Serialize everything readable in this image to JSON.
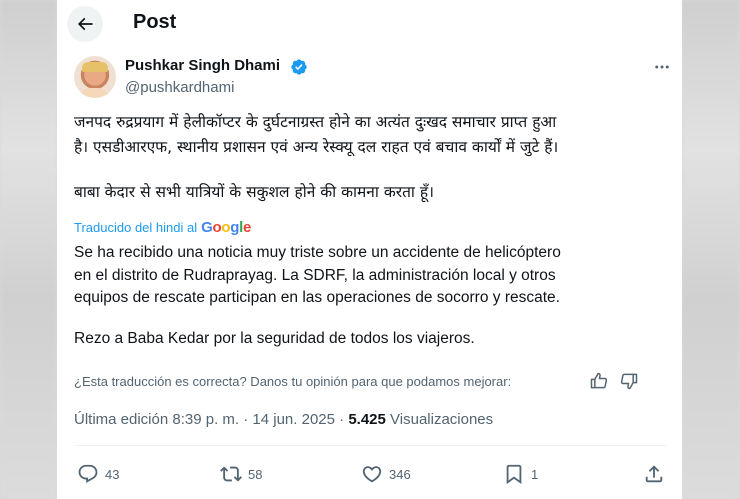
{
  "header": {
    "title": "Post",
    "back_icon": "arrow-left-icon"
  },
  "author": {
    "name": "Pushkar Singh Dhami",
    "handle": "@pushkardhami",
    "verified": true,
    "verified_color": "#1d9bf0"
  },
  "post": {
    "original_paragraphs": [
      "जनपद रुद्रप्रयाग में हेलीकॉप्टर के दुर्घटनाग्रस्त होने का अत्यंत दुःखद समाचार प्राप्त हुआ",
      "है। एसडीआरएफ, स्थानीय प्रशासन एवं अन्य रेस्क्यू दल राहत एवं बचाव कार्यों में जुटे हैं।",
      "बाबा केदार से सभी यात्रियों के सकुशल होने की कामना करता हूँ।"
    ],
    "translated_label": "Traducido del hindi al",
    "translator_logo": "Google",
    "translation_lines": [
      "Se ha recibido una noticia muy triste sobre un accidente de helicóptero",
      "en el distrito de Rudraprayag. La SDRF, la administración local y otros",
      "equipos de rescate participan en las operaciones de socorro y rescate.",
      "Rezo a Baba Kedar por la seguridad de todos los viajeros."
    ],
    "feedback_prompt": "¿Esta traducción es correcta? Danos tu opinión para que podamos mejorar:"
  },
  "meta": {
    "edited_label": "Última edición 8:39 p. m. · 14 jun. 2025 ·",
    "views_count": "5.425",
    "views_label": "Visualizaciones"
  },
  "actions": {
    "replies": "43",
    "reposts": "58",
    "likes": "346",
    "bookmarks": "1"
  },
  "colors": {
    "accent": "#1d9bf0",
    "text": "#0f1419",
    "secondary": "#536471"
  }
}
